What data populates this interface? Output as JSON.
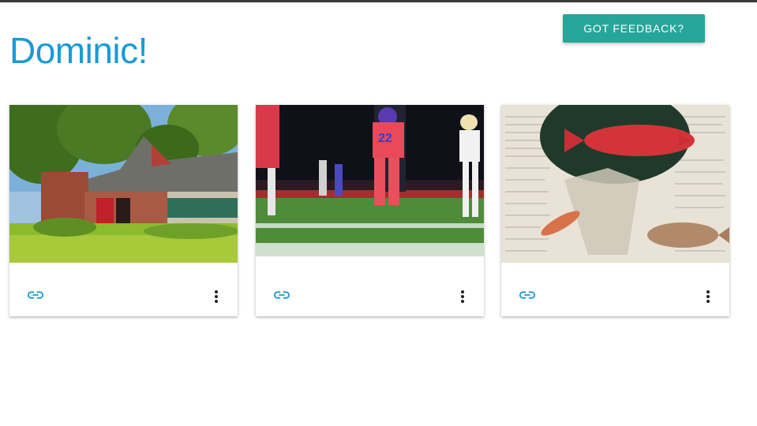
{
  "page": {
    "title": "Dominic!",
    "feedback_label": "GOT FEEDBACK?"
  },
  "colors": {
    "title": "#1a9ad6",
    "feedback_button": "#26a69a",
    "link_icon": "#1a9ad6"
  },
  "cards": [
    {
      "image": "house-photo",
      "actions": [
        "link-icon",
        "more-vert-icon"
      ]
    },
    {
      "image": "football-photo",
      "actions": [
        "link-icon",
        "more-vert-icon"
      ]
    },
    {
      "image": "fish-collage-photo",
      "actions": [
        "link-icon",
        "more-vert-icon"
      ]
    }
  ]
}
